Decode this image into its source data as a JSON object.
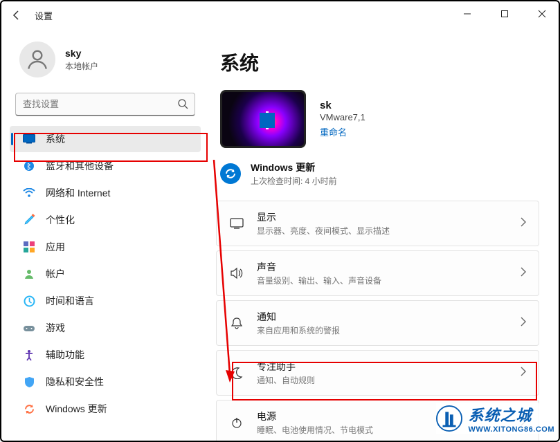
{
  "window": {
    "title": "设置"
  },
  "user": {
    "name": "sky",
    "subtitle": "本地帐户"
  },
  "search": {
    "placeholder": "查找设置"
  },
  "sidebar": {
    "items": [
      {
        "label": "系统"
      },
      {
        "label": "蓝牙和其他设备"
      },
      {
        "label": "网络和 Internet"
      },
      {
        "label": "个性化"
      },
      {
        "label": "应用"
      },
      {
        "label": "帐户"
      },
      {
        "label": "时间和语言"
      },
      {
        "label": "游戏"
      },
      {
        "label": "辅助功能"
      },
      {
        "label": "隐私和安全性"
      },
      {
        "label": "Windows 更新"
      }
    ]
  },
  "main": {
    "page_title": "系统",
    "device": {
      "name": "sk",
      "model": "VMware7,1",
      "rename": "重命名"
    },
    "update": {
      "title": "Windows 更新",
      "subtitle": "上次检查时间: 4 小时前"
    },
    "cards": [
      {
        "title": "显示",
        "sub": "显示器、亮度、夜间模式、显示描述"
      },
      {
        "title": "声音",
        "sub": "音量级别、输出、输入、声音设备"
      },
      {
        "title": "通知",
        "sub": "来自应用和系统的警报"
      },
      {
        "title": "专注助手",
        "sub": "通知、自动规则"
      },
      {
        "title": "电源",
        "sub": "睡眠、电池使用情况、节电模式"
      }
    ]
  },
  "watermark": {
    "cn": "系统之城",
    "url": "WWW.XITONG86.COM"
  }
}
